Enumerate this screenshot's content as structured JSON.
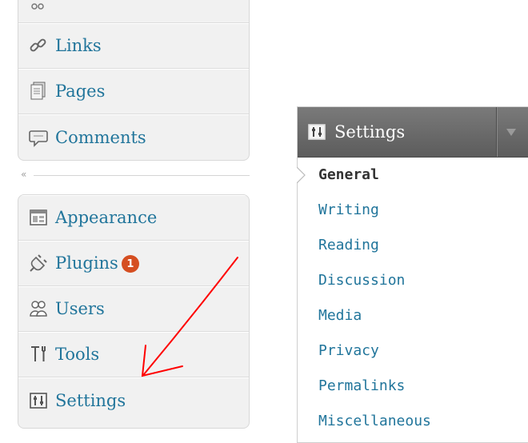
{
  "left_menu": {
    "top_group": [
      {
        "key": "cut",
        "label": "",
        "icon": "partial-icon"
      },
      {
        "key": "links",
        "label": "Links",
        "icon": "links-icon"
      },
      {
        "key": "pages",
        "label": "Pages",
        "icon": "pages-icon"
      },
      {
        "key": "comments",
        "label": "Comments",
        "icon": "comments-icon"
      }
    ],
    "collapse_glyph": "«",
    "bottom_group": [
      {
        "key": "appearance",
        "label": "Appearance",
        "icon": "appearance-icon"
      },
      {
        "key": "plugins",
        "label": "Plugins",
        "icon": "plugins-icon",
        "badge": "1"
      },
      {
        "key": "users",
        "label": "Users",
        "icon": "users-icon"
      },
      {
        "key": "tools",
        "label": "Tools",
        "icon": "tools-icon"
      },
      {
        "key": "settings",
        "label": "Settings",
        "icon": "settings-icon"
      }
    ]
  },
  "submenu": {
    "title": "Settings",
    "items": [
      "General",
      "Writing",
      "Reading",
      "Discussion",
      "Media",
      "Privacy",
      "Permalinks",
      "Miscellaneous"
    ],
    "current": "General"
  },
  "colors": {
    "link": "#21759b",
    "badge": "#d54e21",
    "header_bg": "#6b6b6b",
    "annotation": "#ff0000"
  }
}
